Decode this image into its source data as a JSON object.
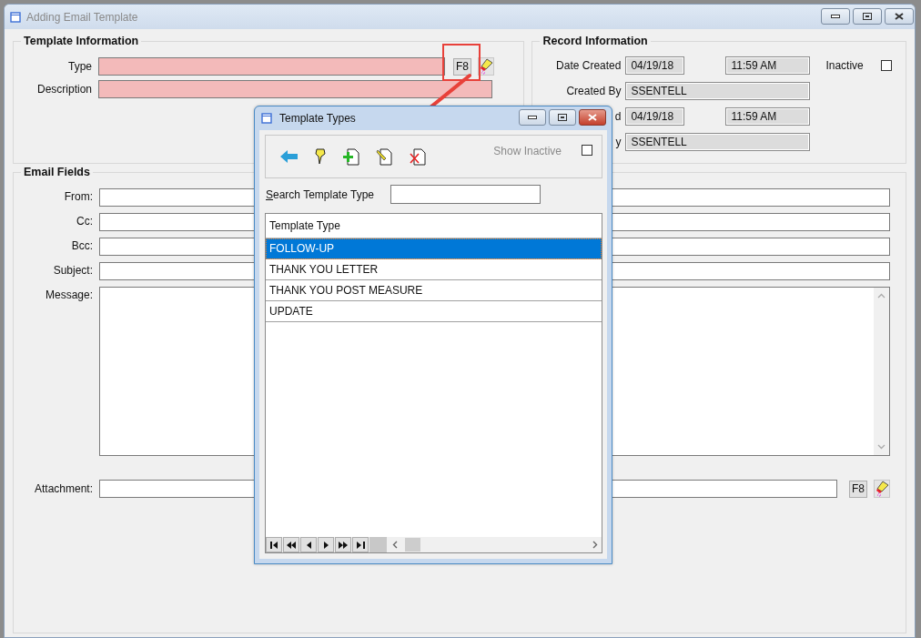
{
  "window": {
    "title": "Adding Email Template"
  },
  "template_information": {
    "title": "Template Information",
    "fields": [
      {
        "label": "Type",
        "required": true,
        "lookup_key": "F8"
      },
      {
        "label": "Description",
        "required": true
      }
    ]
  },
  "record_information": {
    "title": "Record Information",
    "rows": [
      {
        "kind": "datetime",
        "label": "Date Created",
        "date": "04/19/18",
        "time": "11:59 AM"
      },
      {
        "kind": "text",
        "label": "Created By",
        "value": "SSENTELL"
      },
      {
        "kind": "datetime",
        "label": "d",
        "date": "04/19/18",
        "time": "11:59 AM"
      },
      {
        "kind": "text",
        "label": "y",
        "value": "SSENTELL"
      }
    ],
    "inactive": {
      "label": "Inactive",
      "checked": false
    }
  },
  "email_fields": {
    "title": "Email Fields",
    "fields": [
      {
        "kind": "line",
        "label": "From:"
      },
      {
        "kind": "line",
        "label": "Cc:"
      },
      {
        "kind": "line",
        "label": "Bcc:"
      },
      {
        "kind": "line",
        "label": "Subject:"
      },
      {
        "kind": "multiline",
        "label": "Message:"
      },
      {
        "kind": "lookup",
        "label": "Attachment:",
        "lookup_key": "F8"
      }
    ]
  },
  "dialog": {
    "title": "Template Types",
    "show_inactive": {
      "label": "Show Inactive",
      "checked": false
    },
    "search": {
      "label": "Search Template Type"
    },
    "grid": {
      "columns": [
        "Template Type"
      ],
      "rows": [
        {
          "cells": [
            "FOLLOW-UP"
          ],
          "selected": true
        },
        {
          "cells": [
            "THANK YOU LETTER"
          ],
          "selected": false
        },
        {
          "cells": [
            "THANK YOU POST MEASURE"
          ],
          "selected": false
        },
        {
          "cells": [
            "UPDATE"
          ],
          "selected": false
        }
      ]
    }
  }
}
